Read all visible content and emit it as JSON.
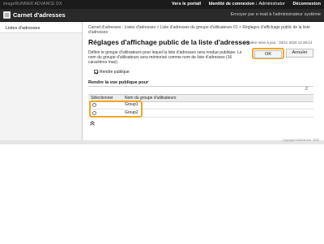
{
  "header": {
    "brand": "imageRUNNER ADVANCE DX",
    "links": {
      "portal": "Vers le portail",
      "login_label": "Identité de connexion :",
      "username": "Administrator",
      "logout": "Déconnexion"
    }
  },
  "titlebar": {
    "title": "Carnet d'adresses",
    "send_mail": "Envoyer par e-mail à l'administrateur système"
  },
  "sidebar": {
    "items": [
      {
        "label": "Listes d'adresses"
      }
    ]
  },
  "main": {
    "breadcrumb": {
      "item1": "Carnet d'adresses : Listes d'adresses",
      "sep": " > ",
      "item2": "Liste d'adresses du groupe d'utilisateurs 01",
      "item3": "Réglages d'affichage public de la liste d'adresses"
    },
    "title": "Réglages d'affichage public de la liste d'adresses",
    "last_updated": "Dernière mise à jour : 03/11 2020 14:28:14",
    "ok_label": "OK",
    "cancel_label": "Annuler",
    "description": "Définir le groupe d'utilisateurs pour lequel la liste d'adresses sera rendue publique. Le nom du groupe d'utilisateurs sera mémorisé comme nom de liste d'adresses (16 caractères max).",
    "make_public_label": "Rendre publique",
    "make_public_checked": true,
    "section_label": "Rendre la vue publique pour",
    "count": "2",
    "table": {
      "headers": {
        "select": "Sélectionner",
        "name": "Nom du groupe d'utilisateurs"
      },
      "rows": [
        {
          "name": "Group1"
        },
        {
          "name": "Group2"
        }
      ]
    },
    "top_nav_icon": "double-chevron-up-icon"
  },
  "footer": {
    "copyright": "Copyright CANON INC. 2020"
  },
  "colors": {
    "accent": "#f1a626",
    "topbar": "#1b1b1b",
    "titlebar": "#2a2a2a"
  }
}
